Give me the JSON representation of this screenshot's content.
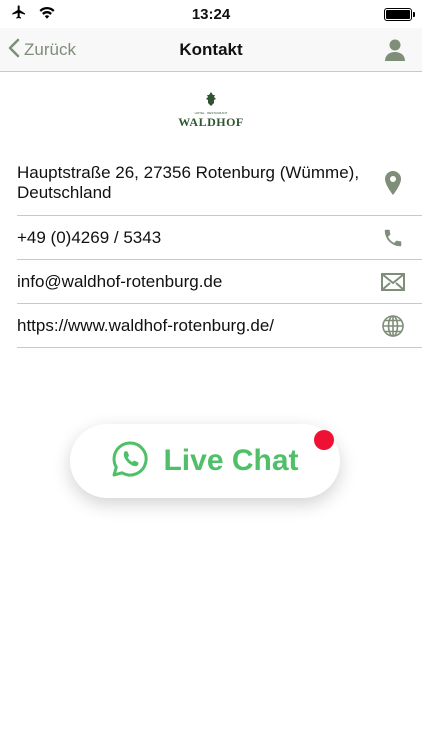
{
  "status": {
    "time": "13:24"
  },
  "nav": {
    "back_label": "Zurück",
    "title": "Kontakt"
  },
  "logo": {
    "wordmark": "WALDHOF",
    "tagline": "HOTEL · RESTAURANT"
  },
  "contact": {
    "address": "Hauptstraße 26, 27356 Rotenburg (Wümme), Deutschland",
    "phone": "+49 (0)4269 / 5343",
    "email": "info@waldhof-rotenburg.de",
    "website": "https://www.waldhof-rotenburg.de/"
  },
  "chat": {
    "label": "Live Chat"
  },
  "colors": {
    "accent": "#7e8e79",
    "chat_green": "#4fc068",
    "badge": "#ee1133"
  }
}
